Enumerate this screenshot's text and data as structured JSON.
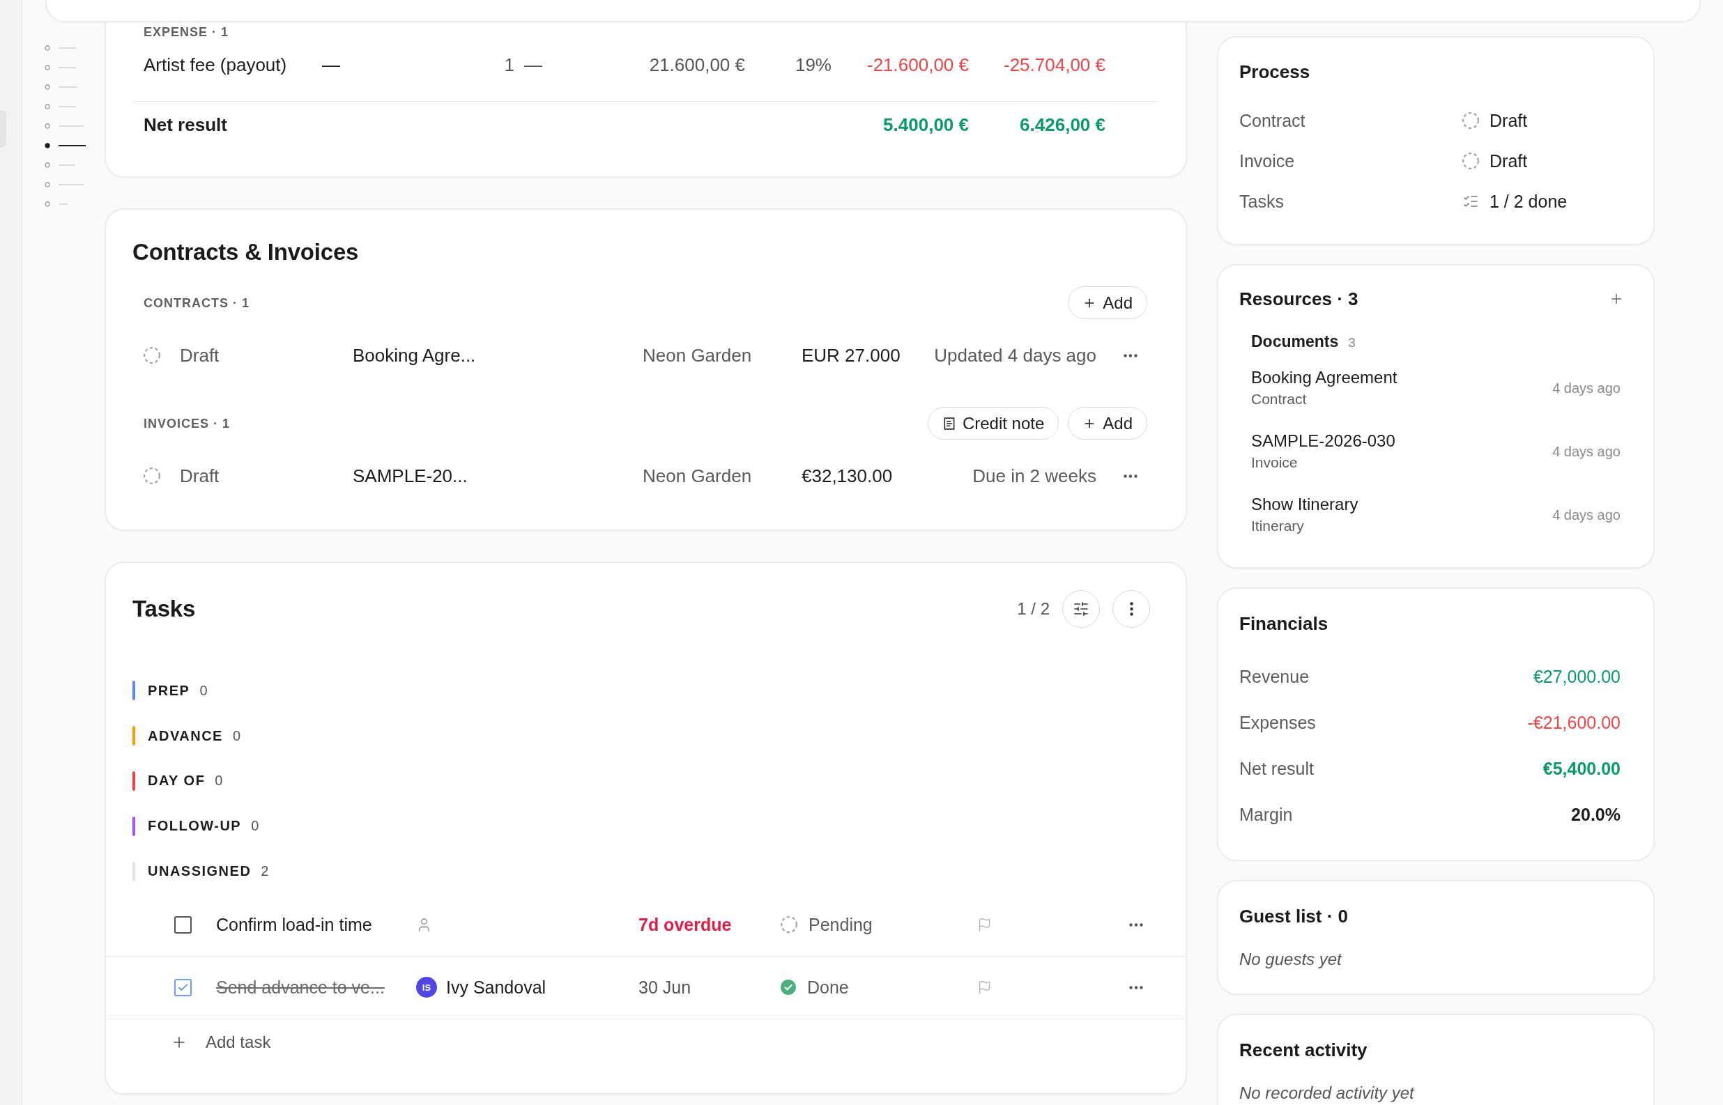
{
  "sidebar": {
    "outline": [
      {
        "selected": false
      },
      {
        "selected": false
      },
      {
        "selected": false
      },
      {
        "selected": false
      },
      {
        "selected": false
      },
      {
        "selected": true
      },
      {
        "selected": false
      },
      {
        "selected": false
      },
      {
        "selected": false
      }
    ]
  },
  "budget": {
    "section": "EXPENSE · 1",
    "rows": [
      {
        "kind": "expense",
        "cells": [
          "Artist fee (payout)",
          "—",
          "1",
          "—",
          "21.600,00 €",
          "19%",
          "-21.600,00 €",
          "-25.704,00 €"
        ]
      }
    ],
    "total": {
      "label": "Net result",
      "negative": false,
      "values": [
        "5.400,00 €",
        "6.426,00 €"
      ]
    }
  },
  "contracts_invoices": {
    "title": "Contracts & Invoices",
    "sections": [
      {
        "label": "CONTRACTS · 1",
        "actions": [
          {
            "kind": "add",
            "label": "Add"
          }
        ],
        "items": [
          {
            "status": {
              "kind": "draft",
              "label": "Draft"
            },
            "title": "Booking Agre...",
            "party": "Neon Garden",
            "amount": "EUR 27.000",
            "meta": "Updated 4 days ago"
          }
        ]
      },
      {
        "label": "INVOICES · 1",
        "actions": [
          {
            "kind": "credit_note",
            "label": "Credit note"
          },
          {
            "kind": "add",
            "label": "Add"
          }
        ],
        "items": [
          {
            "status": {
              "kind": "draft",
              "label": "Draft"
            },
            "title": "SAMPLE-20...",
            "party": "Neon Garden",
            "amount": "€32,130.00",
            "meta": "Due in 2 weeks"
          }
        ]
      }
    ]
  },
  "tasks": {
    "title": "Tasks",
    "progress": "1 / 2",
    "groups": [
      {
        "label": "PREP",
        "count": "0",
        "color": "#5b8def"
      },
      {
        "label": "ADVANCE",
        "count": "0",
        "color": "#f59e0b"
      },
      {
        "label": "DAY OF",
        "count": "0",
        "color": "#ef4444"
      },
      {
        "label": "FOLLOW-UP",
        "count": "0",
        "color": "#a855f7"
      },
      {
        "label": "UNASSIGNED",
        "count": "2",
        "color": "#e2e2e2",
        "tasks": [
          {
            "title": "Confirm load-in time",
            "checked": false,
            "due": "7d overdue",
            "overdue": true,
            "status": {
              "kind": "pending",
              "label": "Pending"
            }
          },
          {
            "title": "Send advance to ve...",
            "checked": true,
            "assignee": {
              "initials": "IS",
              "name": "Ivy Sandoval"
            },
            "due": "30 Jun",
            "overdue": false,
            "status": {
              "kind": "done",
              "label": "Done"
            }
          }
        ]
      }
    ],
    "add_task": "Add task"
  },
  "process": {
    "title": "Process",
    "rows": [
      {
        "label": "Contract",
        "kind": "draft",
        "value": "Draft"
      },
      {
        "label": "Invoice",
        "kind": "draft",
        "value": "Draft"
      },
      {
        "label": "Tasks",
        "kind": "checklist",
        "value": "1 / 2 done"
      }
    ]
  },
  "resources": {
    "title": "Resources · 3",
    "groups": [
      {
        "label": "Documents",
        "count": "3",
        "items": [
          {
            "name": "Booking Agreement",
            "type": "Contract",
            "updated": "4 days ago"
          },
          {
            "name": "SAMPLE-2026-030",
            "type": "Invoice",
            "updated": "4 days ago"
          },
          {
            "name": "Show Itinerary",
            "type": "Itinerary",
            "updated": "4 days ago"
          }
        ]
      }
    ]
  },
  "financials": {
    "title": "Financials",
    "rows": [
      {
        "kind": "revenue",
        "label": "Revenue",
        "value": "€27,000.00"
      },
      {
        "kind": "expense",
        "label": "Expenses",
        "value": "-€21,600.00"
      },
      {
        "kind": "net",
        "label": "Net result",
        "value": "€5,400.00"
      },
      {
        "kind": "margin",
        "label": "Margin",
        "value": "20.0%"
      }
    ]
  },
  "guest_list": {
    "title": "Guest list · 0",
    "empty": "No guests yet"
  },
  "recent_activity": {
    "title": "Recent activity",
    "empty": "No recorded activity yet"
  }
}
